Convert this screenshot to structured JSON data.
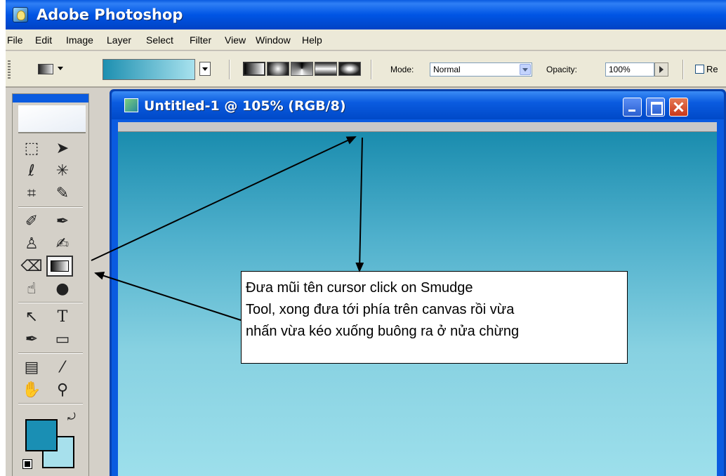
{
  "app": {
    "title": "Adobe Photoshop"
  },
  "menu": [
    {
      "label": "File"
    },
    {
      "label": "Edit"
    },
    {
      "label": "Image"
    },
    {
      "label": "Layer"
    },
    {
      "label": "Select"
    },
    {
      "label": "Filter"
    },
    {
      "label": "View"
    },
    {
      "label": "Window"
    },
    {
      "label": "Help"
    }
  ],
  "options": {
    "mode_label": "Mode:",
    "mode_value": "Normal",
    "opacity_label": "Opacity:",
    "opacity_value": "100%",
    "reverse_label": "Re",
    "gradient_colors": [
      "#1d8fb0",
      "#a8e2ee"
    ]
  },
  "toolbox": {
    "tools": [
      {
        "name": "marquee-tool",
        "glyph": "⬚"
      },
      {
        "name": "move-tool",
        "glyph": "➤"
      },
      {
        "name": "lasso-tool",
        "glyph": "ℓ"
      },
      {
        "name": "magic-wand-tool",
        "glyph": "✳"
      },
      {
        "name": "crop-tool",
        "glyph": "⌗"
      },
      {
        "name": "slice-tool",
        "glyph": "✎"
      },
      {
        "name": "healing-brush-tool",
        "glyph": "✐"
      },
      {
        "name": "brush-tool",
        "glyph": "✒"
      },
      {
        "name": "clone-stamp-tool",
        "glyph": "♙"
      },
      {
        "name": "history-brush-tool",
        "glyph": "✍"
      },
      {
        "name": "eraser-tool",
        "glyph": "⌫"
      },
      {
        "name": "gradient-tool",
        "glyph": ""
      },
      {
        "name": "smudge-tool",
        "glyph": "☝"
      },
      {
        "name": "dodge-tool",
        "glyph": "●"
      },
      {
        "name": "path-selection-tool",
        "glyph": "↖"
      },
      {
        "name": "type-tool",
        "glyph": "T"
      },
      {
        "name": "pen-tool",
        "glyph": "✒"
      },
      {
        "name": "shape-tool",
        "glyph": "▭"
      },
      {
        "name": "notes-tool",
        "glyph": "▤"
      },
      {
        "name": "eyedropper-tool",
        "glyph": "⁄"
      },
      {
        "name": "hand-tool",
        "glyph": "✋"
      },
      {
        "name": "zoom-tool",
        "glyph": "⚲"
      }
    ],
    "foreground_color": "#1a8fb4",
    "background_color": "#a7e0ec"
  },
  "document": {
    "title": "Untitled-1 @ 105% (RGB/8)",
    "canvas_gradient": [
      "#1a8cae",
      "#9ee0ec"
    ]
  },
  "callout": {
    "lines": [
      "Đưa mũi tên cursor click on Smudge",
      "Tool, xong đưa tới phía trên canvas rồi vừa",
      "nhấn vừa kéo xuống buông ra ở nửa chừng"
    ]
  }
}
